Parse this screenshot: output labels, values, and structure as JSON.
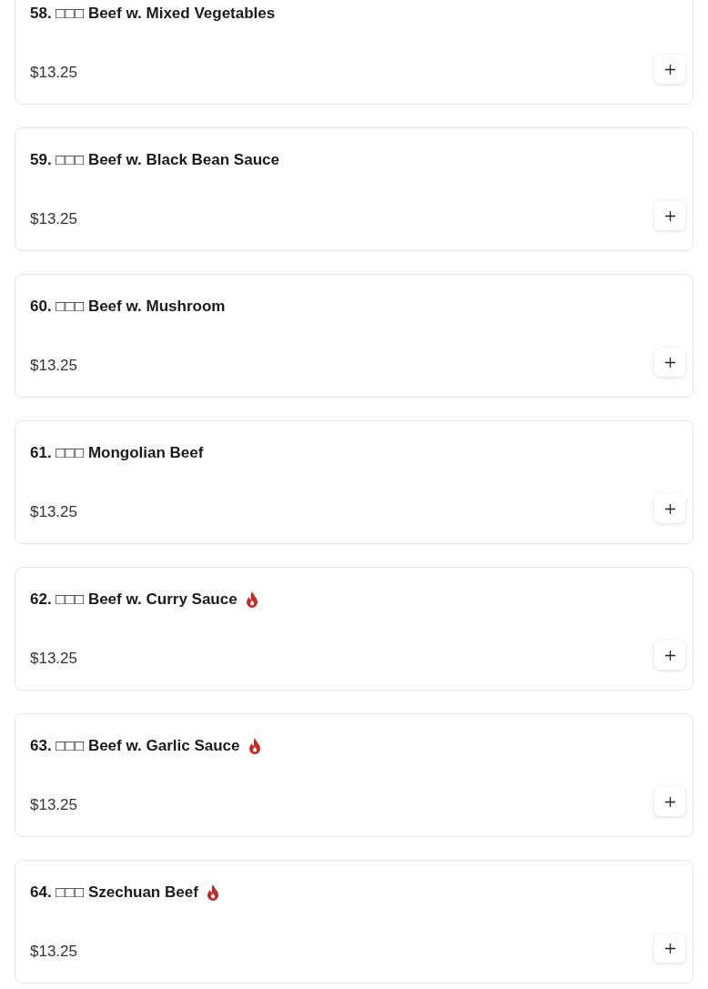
{
  "items": [
    {
      "name": "58. □□□ Beef w. Mixed Vegetables",
      "price": "$13.25",
      "spicy": false
    },
    {
      "name": "59. □□□ Beef w. Black Bean Sauce",
      "price": "$13.25",
      "spicy": false
    },
    {
      "name": "60. □□□ Beef w. Mushroom",
      "price": "$13.25",
      "spicy": false
    },
    {
      "name": "61. □□□ Mongolian Beef",
      "price": "$13.25",
      "spicy": false
    },
    {
      "name": "62. □□□ Beef w. Curry Sauce",
      "price": "$13.25",
      "spicy": true
    },
    {
      "name": "63. □□□ Beef w. Garlic Sauce",
      "price": "$13.25",
      "spicy": true
    },
    {
      "name": "64. □□□ Szechuan Beef",
      "price": "$13.25",
      "spicy": true
    }
  ]
}
